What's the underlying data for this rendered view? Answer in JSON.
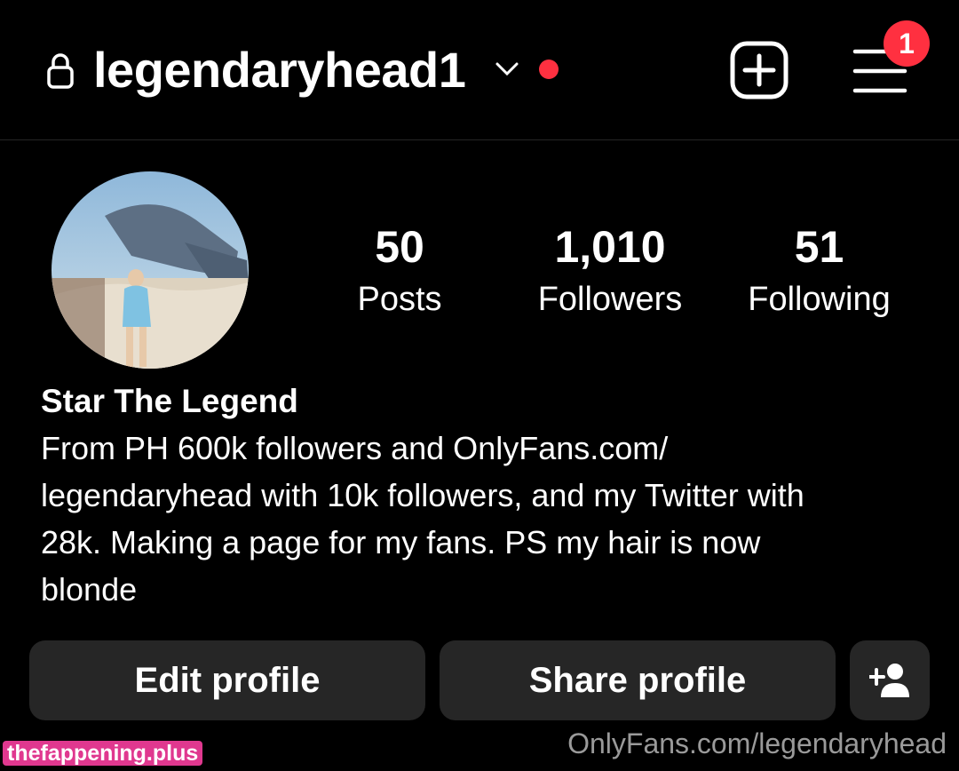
{
  "header": {
    "username": "legendaryhead1",
    "notification_count": "1",
    "lock_icon": "lock-icon",
    "add_icon": "add-post-icon",
    "menu_icon": "hamburger-menu-icon"
  },
  "profile": {
    "avatar_icon": "profile-photo",
    "display_name": "Star The Legend",
    "bio": "From PH 600k followers and OnlyFans.com/\nlegendaryhead with 10k followers, and my Twitter with\n28k. Making a page for my fans. PS my hair is now\nblonde",
    "stats": {
      "posts": {
        "value": "50",
        "label": "Posts"
      },
      "followers": {
        "value": "1,010",
        "label": "Followers"
      },
      "following": {
        "value": "51",
        "label": "Following"
      }
    }
  },
  "actions": {
    "edit_label": "Edit profile",
    "share_label": "Share profile",
    "add_user_icon": "add-user-icon"
  },
  "watermarks": {
    "left": "thefappening.plus",
    "right": "OnlyFans.com/legendaryhead"
  },
  "colors": {
    "background": "#000000",
    "button": "#262626",
    "notification": "#ff3040",
    "watermark_badge": "#e0388f"
  }
}
